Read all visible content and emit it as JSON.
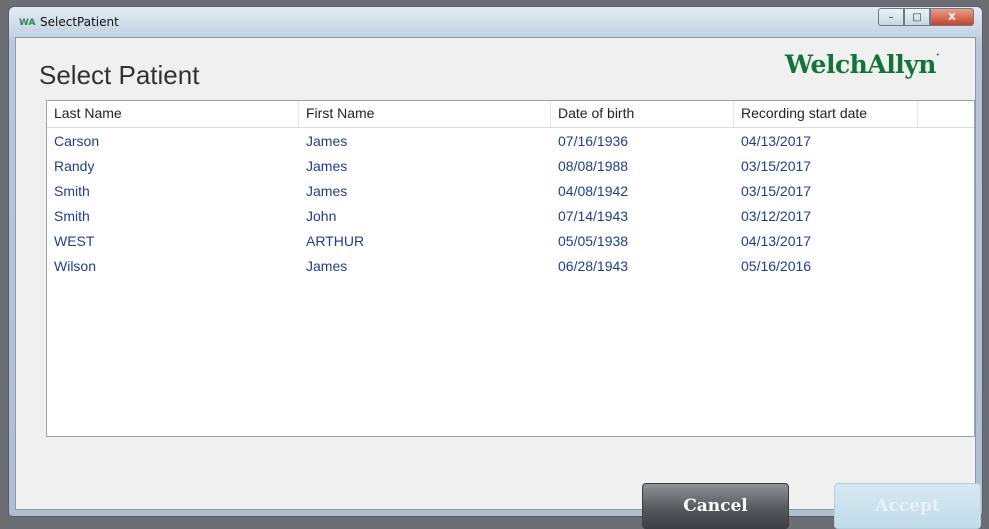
{
  "window": {
    "title": "SelectPatient",
    "app_icon": "WA",
    "controls": {
      "minimize": "–",
      "maximize": "□",
      "close": "X"
    }
  },
  "page": {
    "heading": "Select Patient",
    "logo": "WelchAllyn",
    "logo_mark": "·"
  },
  "table": {
    "headers": [
      "Last Name",
      "First Name",
      "Date of birth",
      "Recording start date",
      ""
    ],
    "rows": [
      {
        "last": "Carson",
        "first": "James",
        "dob": "07/16/1936",
        "start": "04/13/2017"
      },
      {
        "last": "Randy",
        "first": "James",
        "dob": "08/08/1988",
        "start": "03/15/2017"
      },
      {
        "last": "Smith",
        "first": "James",
        "dob": "04/08/1942",
        "start": "03/15/2017"
      },
      {
        "last": "Smith",
        "first": "John",
        "dob": "07/14/1943",
        "start": "03/12/2017"
      },
      {
        "last": "WEST",
        "first": "ARTHUR",
        "dob": "05/05/1938",
        "start": "04/13/2017"
      },
      {
        "last": "Wilson",
        "first": "James",
        "dob": "06/28/1943",
        "start": "05/16/2016"
      }
    ]
  },
  "buttons": {
    "cancel": "Cancel",
    "accept": "Accept"
  },
  "colors": {
    "brand": "#127437",
    "row_text": "#1f3e8a",
    "accept_disabled": "#c2dcea"
  }
}
